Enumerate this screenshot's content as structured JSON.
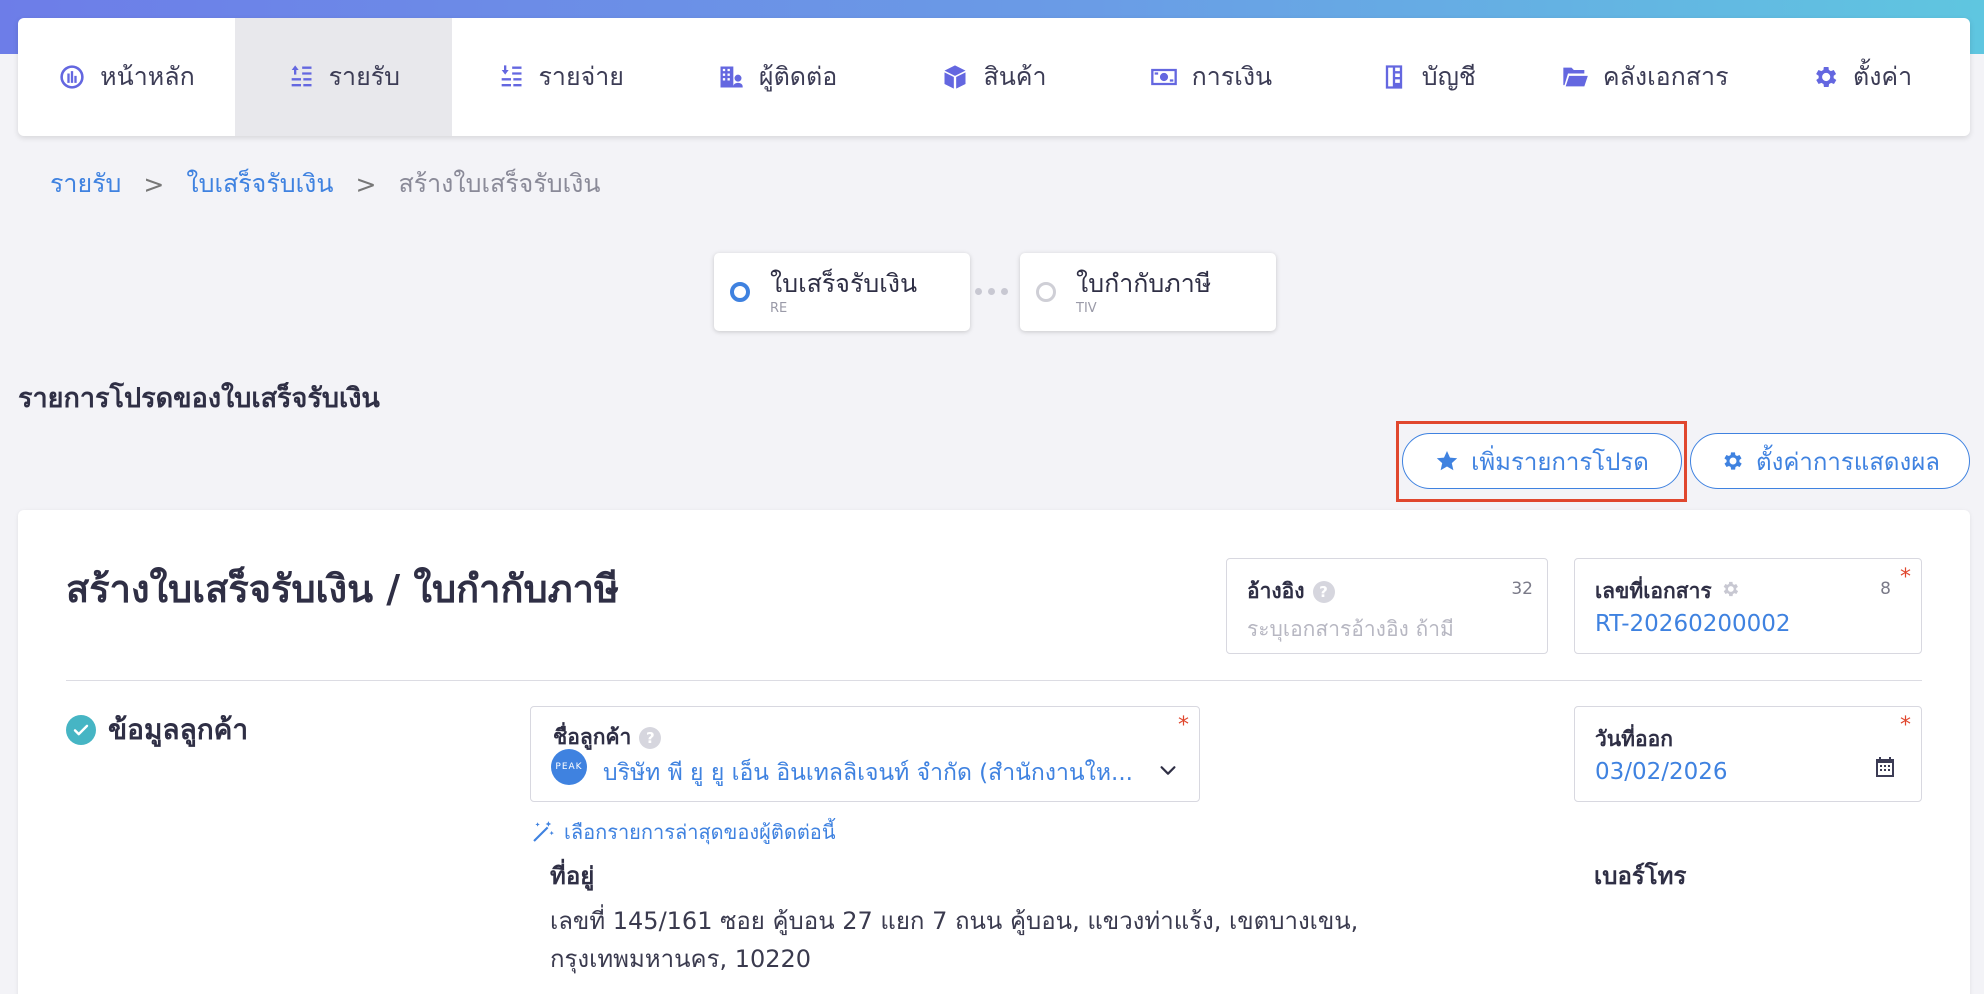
{
  "nav": {
    "items": [
      {
        "label": "หน้าหลัก",
        "icon": "dashboard-icon"
      },
      {
        "label": "รายรับ",
        "icon": "income-icon"
      },
      {
        "label": "รายจ่าย",
        "icon": "expense-icon"
      },
      {
        "label": "ผู้ติดต่อ",
        "icon": "contacts-icon"
      },
      {
        "label": "สินค้า",
        "icon": "product-box-icon"
      },
      {
        "label": "การเงิน",
        "icon": "money-icon"
      },
      {
        "label": "บัญชี",
        "icon": "ledger-icon"
      },
      {
        "label": "คลังเอกสาร",
        "icon": "folder-icon"
      },
      {
        "label": "ตั้งค่า",
        "icon": "gear-icon"
      }
    ],
    "active_index": 1
  },
  "breadcrumb": {
    "level1": "รายรับ",
    "level2": "ใบเสร็จรับเงิน",
    "current": "สร้างใบเสร็จรับเงิน",
    "separator": ">"
  },
  "steps": [
    {
      "title": "ใบเสร็จรับเงิน",
      "code": "RE",
      "active": true
    },
    {
      "title": "ใบกำกับภาษี",
      "code": "TIV",
      "active": false
    }
  ],
  "favorites": {
    "title": "รายการโปรดของใบเสร็จรับเงิน",
    "add_label": "เพิ่มรายการโปรด",
    "settings_label": "ตั้งค่าการแสดงผล"
  },
  "form": {
    "title": "สร้างใบเสร็จรับเงิน / ใบกำกับภาษี",
    "reference": {
      "label": "อ้างอิง",
      "count": "32",
      "placeholder": "ระบุเอกสารอ้างอิง ถ้ามี"
    },
    "doc_number": {
      "label": "เลขที่เอกสาร",
      "count": "8",
      "required": "*",
      "value": "RT-20260200002"
    },
    "customer_section": "ข้อมูลลูกค้า",
    "customer": {
      "label": "ชื่อลูกค้า",
      "required": "*",
      "logo_text": "PEAK",
      "value": "บริษัท พี ยู ยู เอ็น อินเทลลิเจนท์ จำกัด (สำนักงานให..."
    },
    "issue_date": {
      "label": "วันที่ออก",
      "required": "*",
      "value": "03/02/2026"
    },
    "suggest_link": "เลือกรายการล่าสุดของผู้ติดต่อนี้",
    "address_label": "ที่อยู่",
    "address_value": "เลขที่ 145/161 ซอย คู้บอน 27 แยก 7 ถนน คู้บอน, แขวงท่าแร้ง, เขตบางเขน, กรุงเทพมหานคร, 10220",
    "phone_label": "เบอร์โทร"
  },
  "colors": {
    "accent": "#3f82e0",
    "nav_icon": "#6467e0",
    "highlight": "#e0472e",
    "check": "#46b5c4"
  }
}
